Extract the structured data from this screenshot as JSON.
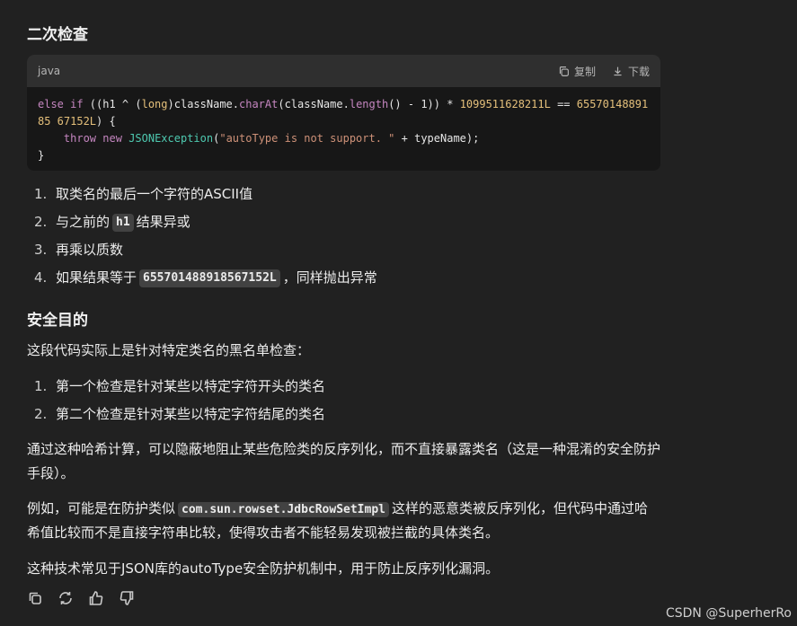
{
  "sections": {
    "check_title": "二次检查",
    "security_title": "安全目的"
  },
  "code": {
    "lang": "java",
    "copy_label": "复制",
    "download_label": "下载",
    "line1_a": "else if",
    "line1_b": " ((h1 ^ (",
    "line1_type": "long",
    "line1_c": ")className.",
    "line1_fn1": "charAt",
    "line1_d": "(className.",
    "line1_fn2": "length",
    "line1_e": "() - 1)) * ",
    "line1_num1": "1099511628211L",
    "line1_f": " == ",
    "line1_num2": "6557014889185 67152L",
    "line1_g": ") {",
    "line2_kw1": "throw",
    "line2_kw2": "new",
    "line2_cls": "JSONException",
    "line2_str": "\"autoType is not support. \"",
    "line2_rest": " + typeName);",
    "line3": "}"
  },
  "steps": [
    {
      "num": "1.",
      "text": "取类名的最后一个字符的ASCII值"
    },
    {
      "num": "2.",
      "pre": "与之前的",
      "code": "h1",
      "post": "结果异或"
    },
    {
      "num": "3.",
      "text": "再乘以质数"
    },
    {
      "num": "4.",
      "pre": "如果结果等于",
      "code": "655701488918567152L",
      "post": "，同样抛出异常"
    }
  ],
  "intro": "这段代码实际上是针对特定类名的黑名单检查：",
  "purpose": [
    {
      "num": "1.",
      "text": "第一个检查是针对某些以特定字符开头的类名"
    },
    {
      "num": "2.",
      "text": "第二个检查是针对某些以特定字符结尾的类名"
    }
  ],
  "para1": "通过这种哈希计算，可以隐蔽地阻止某些危险类的反序列化，而不直接暴露类名（这是一种混淆的安全防护手段）。",
  "para2_pre": "例如，可能是在防护类似",
  "para2_code": "com.sun.rowset.JdbcRowSetImpl",
  "para2_post": "这样的恶意类被反序列化，但代码中通过哈希值比较而不是直接字符串比较，使得攻击者不能轻易发现被拦截的具体类名。",
  "para3": "这种技术常见于JSON库的autoType安全防护机制中，用于防止反序列化漏洞。",
  "watermark": "CSDN @SuperherRo",
  "icons": [
    "copy-icon",
    "regenerate-icon",
    "thumbs-up-icon",
    "thumbs-down-icon"
  ]
}
